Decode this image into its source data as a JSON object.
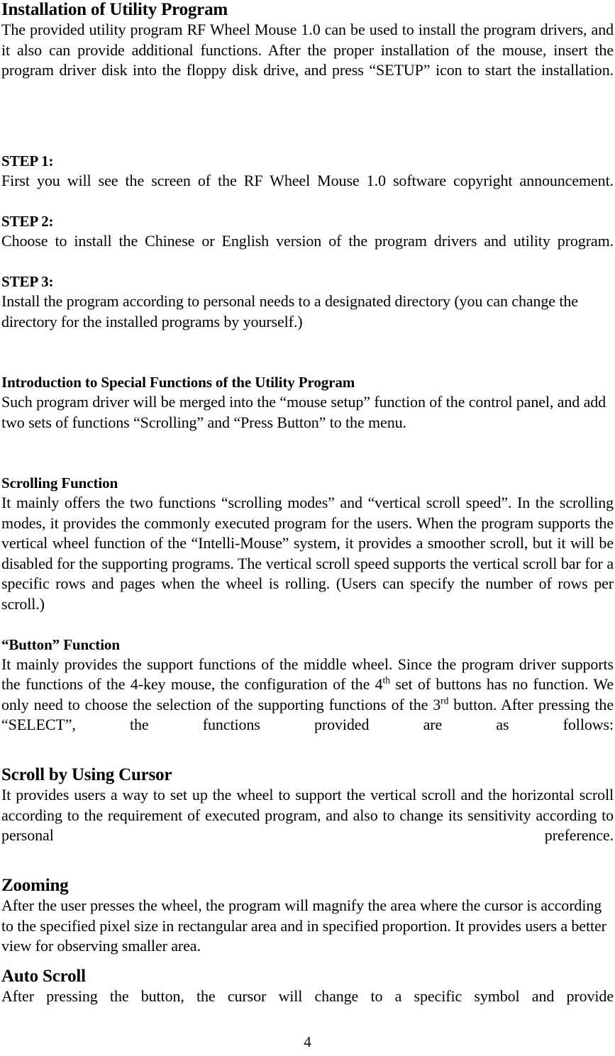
{
  "document": {
    "page_number": "4",
    "sections": [
      {
        "id": "installation",
        "heading": "Installation of Utility Program",
        "body": "The provided utility program  RF Wheel Mouse 1.0 can be used to install the program drivers, and it also can provide additional functions. After the proper installation of the mouse, insert the program driver disk into the floppy disk drive, and press “SETUP” icon to start the installation."
      },
      {
        "id": "step-1",
        "heading": "STEP 1:",
        "body": "First you will see the screen of the  RF Wheel Mouse 1.0  software copyright announcement."
      },
      {
        "id": "step-2",
        "heading": "STEP 2:",
        "body": "Choose to install the Chinese or English version of the program drivers and utility program."
      },
      {
        "id": "step-3",
        "heading": "STEP 3:",
        "body": "Install the program according to personal needs to a designated directory (you can change the directory for the installed programs by yourself.)"
      },
      {
        "id": "introduction-special-functions",
        "heading": "Introduction to Special Functions of the Utility Program",
        "body": "Such program driver will be merged into the “mouse setup” function of the control panel, and add two sets of functions “Scrolling” and “Press Button” to the menu."
      },
      {
        "id": "scrolling-function",
        "heading": "Scrolling Function",
        "body": "It mainly offers the two functions “scrolling modes” and “vertical scroll speed”.  In the scrolling modes, it provides the commonly executed program for the users.  When the program supports the vertical wheel function of the “Intelli-Mouse” system, it provides a smoother scroll, but it will be disabled for the supporting programs.  The vertical scroll speed supports the vertical scroll bar for a specific rows and pages when the wheel is rolling.  (Users can specify the number of rows per scroll.)"
      },
      {
        "id": "button-function",
        "heading": "“Button” Function",
        "body_part_1": "It mainly provides the support functions of the middle wheel.  Since the program driver supports the functions of the 4-key mouse, the configuration of the 4",
        "body_sup_1": "th",
        "body_part_2": " set of buttons has no function.  We only need to choose the selection of the supporting functions of the 3",
        "body_sup_2": "rd",
        "body_part_3": " button.  After pressing the “SELECT”, the functions provided are as follows:"
      },
      {
        "id": "scroll-by-using-cursor",
        "heading": "Scroll by Using Cursor",
        "body": "It provides users a way to set up the wheel to support the vertical scroll and the horizontal scroll according to the requirement of executed program, and also to change its sensitivity according to personal preference."
      },
      {
        "id": "zooming",
        "heading": "Zooming",
        "body": "After the user presses the wheel, the program will magnify the area where the cursor is according to the specified pixel size in rectangular area and in specified proportion. It provides users a better view for observing smaller area."
      },
      {
        "id": "auto-scroll",
        "heading": "Auto Scroll",
        "body": "After pressing the button, the cursor will change to a specific symbol and provide"
      }
    ]
  }
}
